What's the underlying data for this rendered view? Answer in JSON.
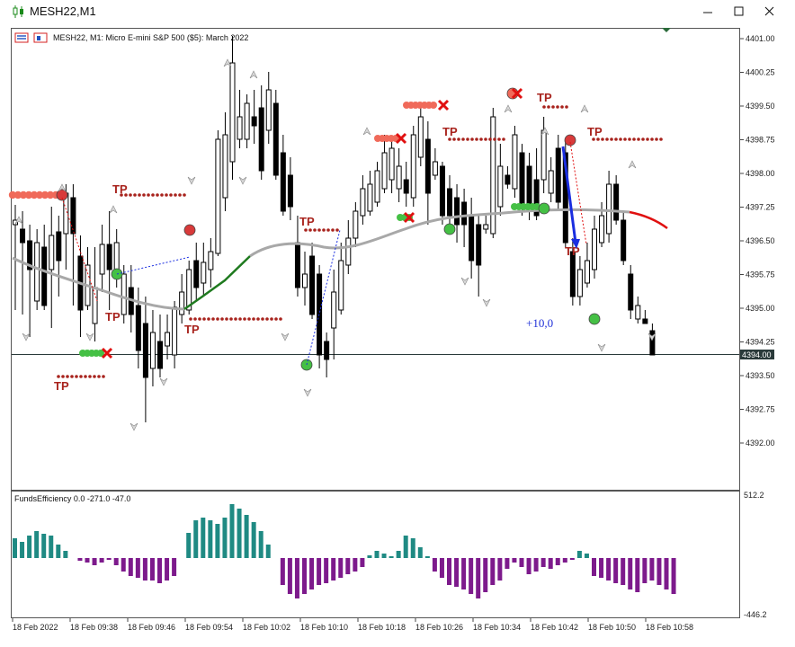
{
  "window": {
    "title": "MESH22,M1",
    "icon": "candlestick-icon",
    "controls": [
      "minimize-icon",
      "maximize-icon",
      "close-icon"
    ]
  },
  "chart": {
    "info": "MESH22, M1:  Micro E-mini S&P 500 ($5): March 2022",
    "current_price_label": "4394.00",
    "price_ticks": [
      "4401.00",
      "4400.25",
      "4399.50",
      "4398.75",
      "4398.00",
      "4397.25",
      "4396.50",
      "4395.75",
      "4395.00",
      "4394.25",
      "4393.50",
      "4392.75",
      "4392.00"
    ],
    "profit_label": "+10,0",
    "tp_label": "TP",
    "time_labels": [
      "18 Feb 2022",
      "18 Feb 09:38",
      "18 Feb 09:46",
      "18 Feb 09:54",
      "18 Feb 10:02",
      "18 Feb 10:10",
      "18 Feb 10:18",
      "18 Feb 10:26",
      "18 Feb 10:34",
      "18 Feb 10:42",
      "18 Feb 10:50",
      "18 Feb 10:58"
    ]
  },
  "indicator": {
    "label": "FundsEfficiency 0.0 -271.0 -47.0",
    "scale_top": "512.2",
    "scale_bottom": "-446.2",
    "colors": {
      "positive": "#1f8a83",
      "negative": "#7d1a8c"
    }
  },
  "colors": {
    "bull_candle": "#ffffff",
    "bear_candle": "#000000",
    "ma_gray": "#a8a8a8",
    "ma_green": "#1f7a1f",
    "ma_red": "#e01010",
    "tp_color": "#a8231d",
    "arrow_blue": "#1a2ee0"
  }
}
